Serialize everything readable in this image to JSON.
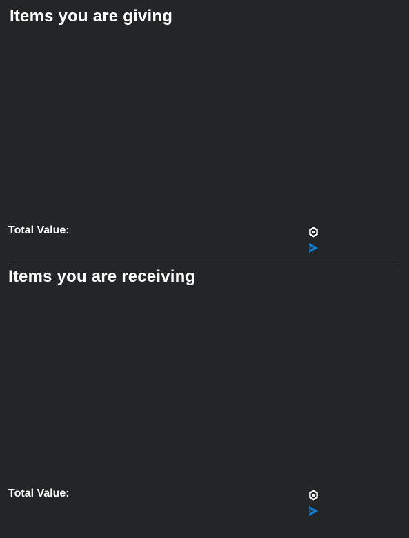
{
  "giving": {
    "title": "Items you are giving",
    "total_label": "Total Value:",
    "robux_value": "",
    "rolimons_value": ""
  },
  "receiving": {
    "title": "Items you are receiving",
    "total_label": "Total Value:",
    "robux_value": "",
    "rolimons_value": ""
  },
  "colors": {
    "background": "#232527",
    "text": "#ffffff",
    "divider": "#4f5155",
    "rolimons_icon": "#0e7fd6"
  },
  "icons": {
    "robux": "robux-icon",
    "rolimons": "rolimons-value-icon"
  }
}
